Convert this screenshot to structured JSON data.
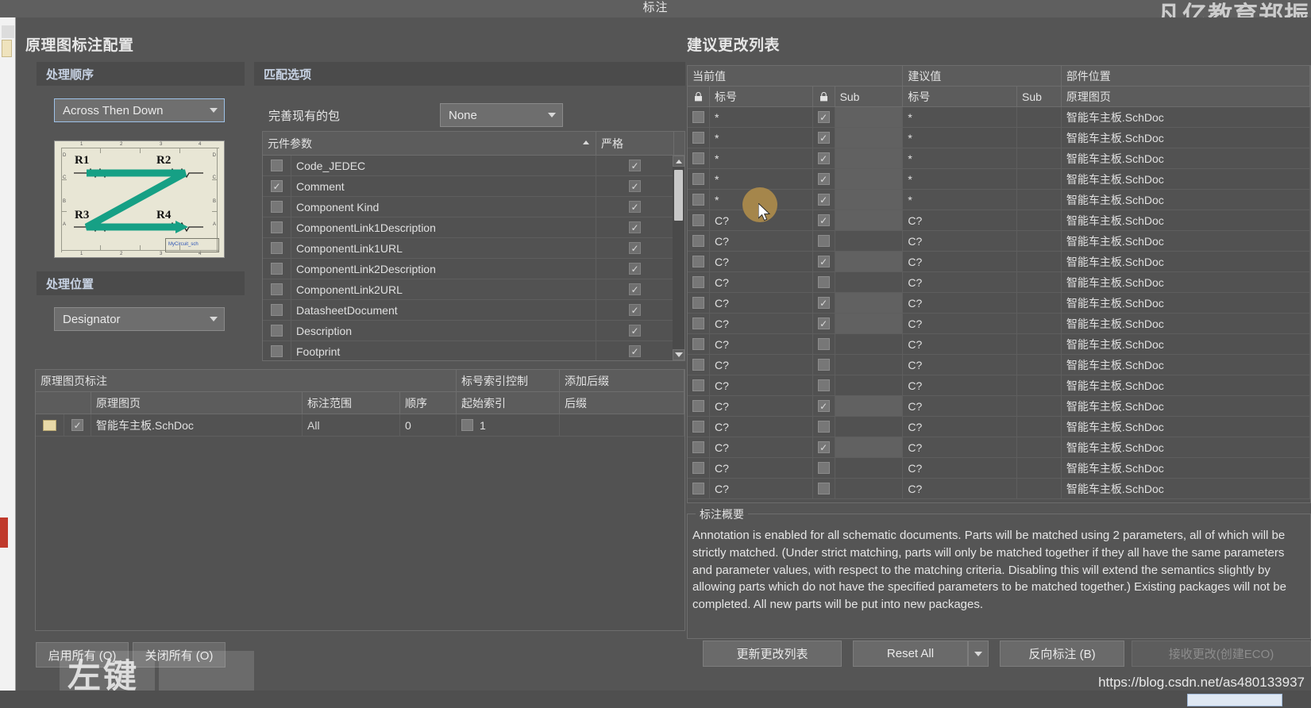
{
  "window": {
    "title": "标注",
    "watermark_top_right": "凡亿教育郑振",
    "watermark_url": "https://blog.csdn.net/as480133937",
    "overlay_key_hint": "左键"
  },
  "left_panel": {
    "title": "原理图标注配置",
    "order_group": {
      "label": "处理顺序",
      "combo_value": "Across Then Down",
      "preview": {
        "designators": [
          "R1",
          "R2",
          "R3",
          "R4"
        ],
        "title_block": "MyCircuit_sch",
        "ruler_numbers": [
          "1",
          "2",
          "3",
          "4"
        ],
        "side_letters": [
          "D",
          "C",
          "B",
          "A"
        ]
      }
    },
    "location_group": {
      "label": "处理位置",
      "combo_value": "Designator"
    },
    "match_group": {
      "label": "匹配选项",
      "existing_packages_label": "完善现有的包",
      "existing_packages_value": "None",
      "param_table": {
        "headers": [
          "元件参数",
          "严格"
        ],
        "sort_indicator": "ascending",
        "rows": [
          {
            "checked": false,
            "name": "Code_JEDEC",
            "strict": true
          },
          {
            "checked": true,
            "name": "Comment",
            "strict": true
          },
          {
            "checked": false,
            "name": "Component Kind",
            "strict": true
          },
          {
            "checked": false,
            "name": "ComponentLink1Description",
            "strict": true
          },
          {
            "checked": false,
            "name": "ComponentLink1URL",
            "strict": true
          },
          {
            "checked": false,
            "name": "ComponentLink2Description",
            "strict": true
          },
          {
            "checked": false,
            "name": "ComponentLink2URL",
            "strict": true
          },
          {
            "checked": false,
            "name": "DatasheetDocument",
            "strict": true
          },
          {
            "checked": false,
            "name": "Description",
            "strict": true
          },
          {
            "checked": false,
            "name": "Footprint",
            "strict": true
          }
        ]
      }
    },
    "sheet_table": {
      "group_headers": [
        "原理图页标注",
        "标号索引控制",
        "添加后缀"
      ],
      "headers": [
        "原理图页",
        "标注范围",
        "顺序",
        "起始索引",
        "后缀"
      ],
      "rows": [
        {
          "icon": "sheet-icon",
          "enabled": true,
          "sheet": "智能车主板.SchDoc",
          "scope": "All",
          "order": "0",
          "start_index_checked": false,
          "start_index": "1",
          "suffix": ""
        }
      ]
    },
    "buttons": {
      "enable_all": "启用所有 (O)",
      "disable_all": "关闭所有 (O)"
    }
  },
  "right_panel": {
    "title": "建议更改列表",
    "group_headers": [
      "当前值",
      "建议值",
      "部件位置"
    ],
    "sub_headers": {
      "lock1": "lock-icon",
      "designator1": "标号",
      "lock2": "lock-icon",
      "sub1": "Sub",
      "designator2": "标号",
      "sub2": "Sub",
      "schematic": "原理图页"
    },
    "rows": [
      {
        "sel": false,
        "cur": "*",
        "lock": true,
        "cur_sub": "",
        "new": "*",
        "new_sub": "",
        "sheet": "智能车主板.SchDoc"
      },
      {
        "sel": false,
        "cur": "*",
        "lock": true,
        "cur_sub": "",
        "new": "*",
        "new_sub": "",
        "sheet": "智能车主板.SchDoc"
      },
      {
        "sel": false,
        "cur": "*",
        "lock": true,
        "cur_sub": "",
        "new": "*",
        "new_sub": "",
        "sheet": "智能车主板.SchDoc"
      },
      {
        "sel": false,
        "cur": "*",
        "lock": true,
        "cur_sub": "",
        "new": "*",
        "new_sub": "",
        "sheet": "智能车主板.SchDoc"
      },
      {
        "sel": false,
        "cur": "*",
        "lock": true,
        "cur_sub": "",
        "new": "*",
        "new_sub": "",
        "sheet": "智能车主板.SchDoc"
      },
      {
        "sel": false,
        "cur": "C?",
        "lock": true,
        "cur_sub": "",
        "new": "C?",
        "new_sub": "",
        "sheet": "智能车主板.SchDoc"
      },
      {
        "sel": false,
        "cur": "C?",
        "lock": false,
        "cur_sub": "",
        "new": "C?",
        "new_sub": "",
        "sheet": "智能车主板.SchDoc"
      },
      {
        "sel": false,
        "cur": "C?",
        "lock": true,
        "cur_sub": "",
        "new": "C?",
        "new_sub": "",
        "sheet": "智能车主板.SchDoc"
      },
      {
        "sel": false,
        "cur": "C?",
        "lock": false,
        "cur_sub": "",
        "new": "C?",
        "new_sub": "",
        "sheet": "智能车主板.SchDoc"
      },
      {
        "sel": false,
        "cur": "C?",
        "lock": true,
        "cur_sub": "",
        "new": "C?",
        "new_sub": "",
        "sheet": "智能车主板.SchDoc"
      },
      {
        "sel": false,
        "cur": "C?",
        "lock": true,
        "cur_sub": "",
        "new": "C?",
        "new_sub": "",
        "sheet": "智能车主板.SchDoc"
      },
      {
        "sel": false,
        "cur": "C?",
        "lock": false,
        "cur_sub": "",
        "new": "C?",
        "new_sub": "",
        "sheet": "智能车主板.SchDoc"
      },
      {
        "sel": false,
        "cur": "C?",
        "lock": false,
        "cur_sub": "",
        "new": "C?",
        "new_sub": "",
        "sheet": "智能车主板.SchDoc"
      },
      {
        "sel": false,
        "cur": "C?",
        "lock": false,
        "cur_sub": "",
        "new": "C?",
        "new_sub": "",
        "sheet": "智能车主板.SchDoc"
      },
      {
        "sel": false,
        "cur": "C?",
        "lock": true,
        "cur_sub": "",
        "new": "C?",
        "new_sub": "",
        "sheet": "智能车主板.SchDoc"
      },
      {
        "sel": false,
        "cur": "C?",
        "lock": false,
        "cur_sub": "",
        "new": "C?",
        "new_sub": "",
        "sheet": "智能车主板.SchDoc"
      },
      {
        "sel": false,
        "cur": "C?",
        "lock": true,
        "cur_sub": "",
        "new": "C?",
        "new_sub": "",
        "sheet": "智能车主板.SchDoc"
      },
      {
        "sel": false,
        "cur": "C?",
        "lock": false,
        "cur_sub": "",
        "new": "C?",
        "new_sub": "",
        "sheet": "智能车主板.SchDoc"
      },
      {
        "sel": false,
        "cur": "C?",
        "lock": false,
        "cur_sub": "",
        "new": "C?",
        "new_sub": "",
        "sheet": "智能车主板.SchDoc"
      }
    ],
    "summary": {
      "legend": "标注概要",
      "text": "Annotation is enabled for all schematic documents. Parts will be matched using 2 parameters, all of which will be strictly matched. (Under strict matching, parts will only be matched together if they all have the same parameters and parameter values, with respect to the matching criteria. Disabling this will extend the semantics slightly by allowing parts which do not have the specified parameters to be matched together.) Existing packages will not be completed. All new parts will be put into new packages."
    },
    "buttons": {
      "update_list": "更新更改列表",
      "reset_all": "Reset All",
      "back_annotate": "反向标注 (B)",
      "accept_changes": "接收更改(创建ECO)"
    }
  },
  "colors": {
    "accent_blue": "#9ec2e8",
    "click_blob": "#b08d4a",
    "panel_bg": "#555555",
    "table_bg": "#525252"
  }
}
